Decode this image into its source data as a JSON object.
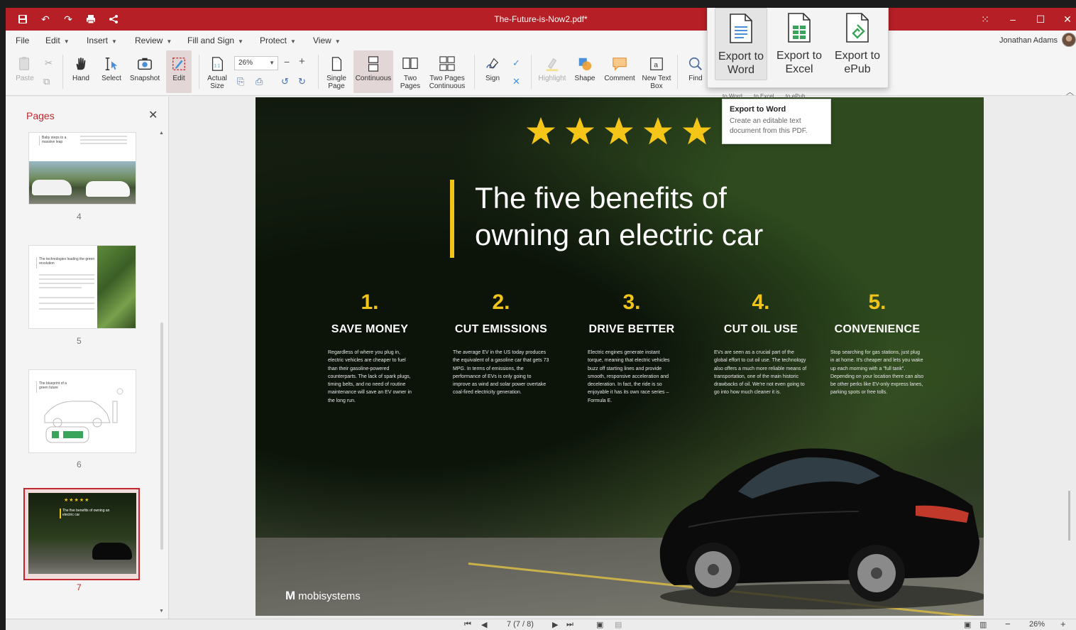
{
  "window": {
    "title": "The-Future-is-Now2.pdf*",
    "user": "Jonathan Adams"
  },
  "menu": [
    "File",
    "Edit",
    "Insert",
    "Review",
    "Fill and Sign",
    "Protect",
    "View"
  ],
  "ribbon": {
    "paste": "Paste",
    "hand": "Hand",
    "select": "Select",
    "snapshot": "Snapshot",
    "edit": "Edit",
    "actual_size": "Actual Size",
    "zoom": "26%",
    "single_page": "Single Page",
    "continuous": "Continuous",
    "two_pages": "Two Pages",
    "two_pages_continuous": "Two Pages Continuous",
    "sign": "Sign",
    "highlight": "Highlight",
    "shape": "Shape",
    "comment": "Comment",
    "new_text_box": "New Text Box",
    "find": "Find"
  },
  "export_popup": {
    "word": "Export to Word",
    "excel": "Export to Excel",
    "epub": "Export to ePub",
    "under_labels": [
      "to Word",
      "to Excel",
      "to ePub"
    ]
  },
  "tooltip": {
    "title": "Export to Word",
    "text": "Create an editable text document from this PDF."
  },
  "sidebar": {
    "title": "Pages",
    "pages": [
      {
        "num": "4",
        "caption": "Baby steps to a massive leap"
      },
      {
        "num": "5",
        "caption": "The technologies leading the green revolution"
      },
      {
        "num": "6",
        "caption": "The blueprint of a green future"
      },
      {
        "num": "7",
        "caption": "The five benefits of owning an electric car"
      }
    ]
  },
  "page": {
    "headline_line1": "The five benefits of",
    "headline_line2": "owning an electric car",
    "logo": "mobisystems",
    "benefits": [
      {
        "num": "1.",
        "name": "SAVE MONEY",
        "body": "Regardless of where you plug in, electric vehicles are cheaper to fuel than their gasoline-powered counterparts. The lack of spark plugs, timing belts, and no need of routine maintenance will save an EV owner in the long run."
      },
      {
        "num": "2.",
        "name": "CUT EMISSIONS",
        "body": "The average EV in the US today produces the equivalent of a gasoline car that gets 73 MPG. In terms of emissions, the performance of EVs is only going to improve as wind and solar power overtake coal-fired electricity generation."
      },
      {
        "num": "3.",
        "name": "DRIVE BETTER",
        "body": "Electric engines generate instant torque, meaning that electric vehicles buzz off starting lines and provide smooth, responsive acceleration and deceleration. In fact, the ride is so enjoyable it has its own race series – Formula E."
      },
      {
        "num": "4.",
        "name": "CUT OIL USE",
        "body": "EVs are seen as a crucial part of the global effort to cut oil use. The technology also offers a much more reliable means of transportation, one of the main historic drawbacks of oil. We're not even going to go into how much cleaner it is."
      },
      {
        "num": "5.",
        "name": "CONVENIENCE",
        "body": "Stop searching for gas stations, just plug in at home. It's cheaper and lets you wake up each morning with a \"full tank\". Depending on your location there can also be other perks like EV-only express lanes, parking spots or free tolls."
      }
    ]
  },
  "status": {
    "page_indicator": "7 (7 / 8)",
    "zoom": "26%"
  },
  "colors": {
    "accent": "#b51f25",
    "highlight_yellow": "#f0c419"
  }
}
